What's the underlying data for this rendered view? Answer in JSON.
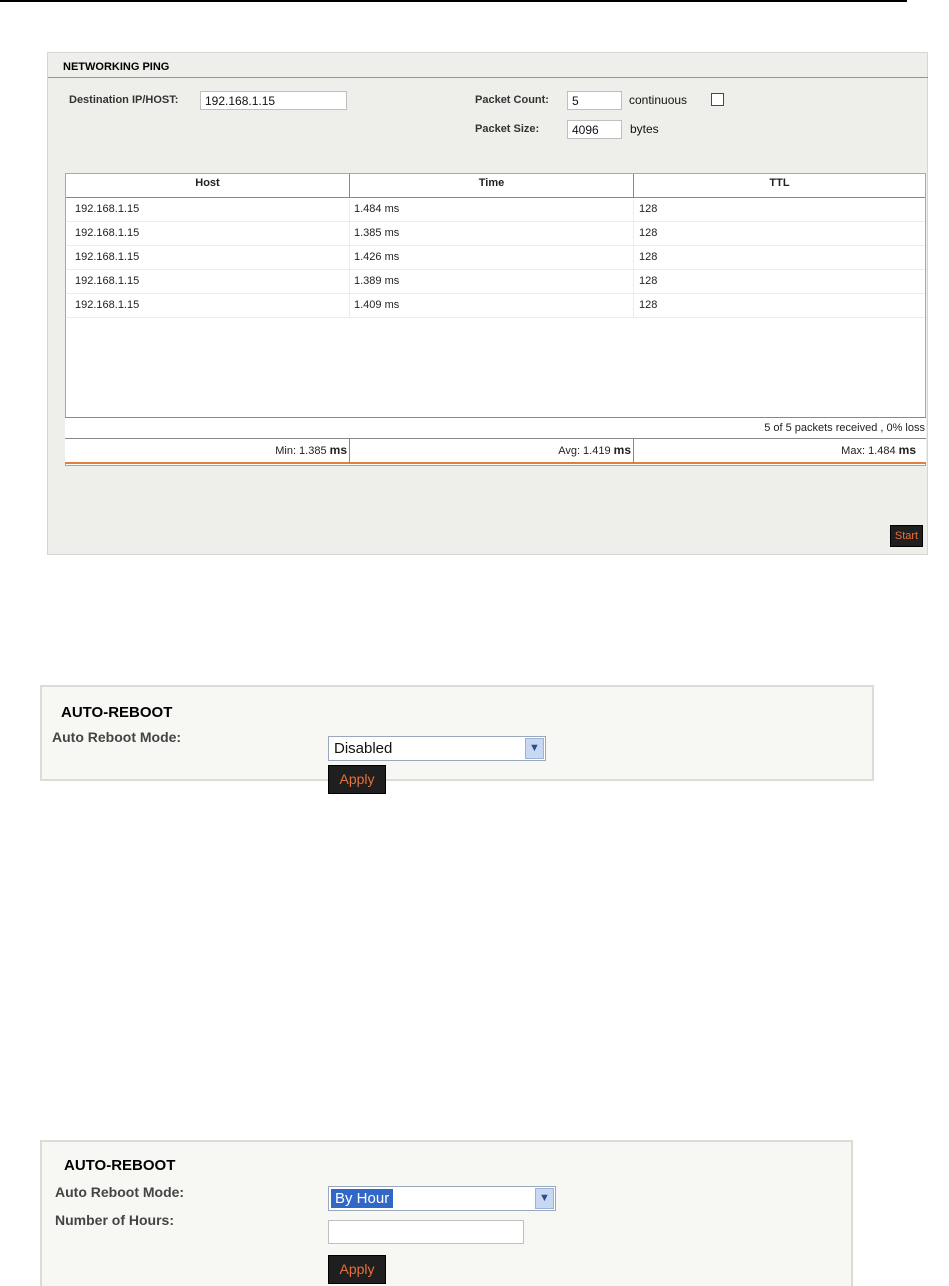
{
  "ping": {
    "title": "NETWORKING PING",
    "destination_label": "Destination IP/HOST:",
    "destination_value": "192.168.1.15",
    "packet_count_label": "Packet Count:",
    "packet_count_value": "5",
    "continuous_label": "continuous",
    "continuous_checked": false,
    "packet_size_label": "Packet Size:",
    "packet_size_value": "4096",
    "packet_size_unit": "bytes",
    "columns": [
      "Host",
      "Time",
      "TTL"
    ],
    "rows": [
      {
        "host": "192.168.1.15",
        "time": "1.484 ms",
        "ttl": "128"
      },
      {
        "host": "192.168.1.15",
        "time": "1.385 ms",
        "ttl": "128"
      },
      {
        "host": "192.168.1.15",
        "time": "1.426 ms",
        "ttl": "128"
      },
      {
        "host": "192.168.1.15",
        "time": "1.389 ms",
        "ttl": "128"
      },
      {
        "host": "192.168.1.15",
        "time": "1.409 ms",
        "ttl": "128"
      }
    ],
    "summary": "5 of 5 packets received , 0% loss",
    "min_label": "Min: 1.385",
    "avg_label": "Avg: 1.419",
    "max_label": "Max: 1.484",
    "stat_unit": "ms",
    "start_label": "Start"
  },
  "auto_reboot_1": {
    "title": "AUTO-REBOOT",
    "mode_label": "Auto Reboot Mode:",
    "mode_value": "Disabled",
    "apply_label": "Apply"
  },
  "auto_reboot_2": {
    "title": "AUTO-REBOOT",
    "mode_label": "Auto Reboot Mode:",
    "mode_value": "By Hour",
    "hours_label": "Number of Hours:",
    "hours_value": "",
    "apply_label": "Apply"
  },
  "colors": {
    "accent_orange": "#e0803c",
    "button_bg": "#1f1f1f",
    "button_text": "#e8703a",
    "panel_bg": "#eeeeea",
    "select_highlight": "#3168c8"
  },
  "icons": [
    "chevron-down-icon"
  ]
}
